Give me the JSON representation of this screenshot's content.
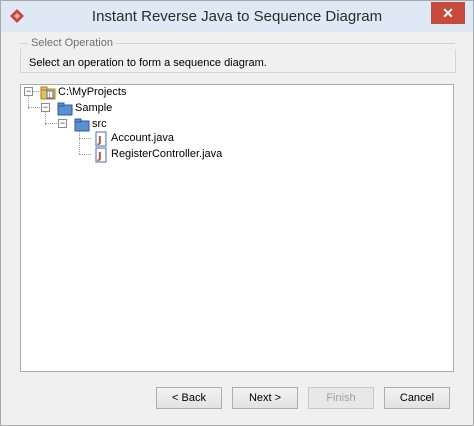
{
  "window": {
    "title": "Instant Reverse Java to Sequence Diagram",
    "close_label": "✕"
  },
  "group": {
    "label": "Select Operation",
    "instruction": "Select an operation to form a sequence diagram."
  },
  "tree": {
    "root": "C:\\MyProjects",
    "project": "Sample",
    "folder": "src",
    "files": [
      "Account.java",
      "RegisterController.java"
    ]
  },
  "buttons": {
    "back": "< Back",
    "next": "Next >",
    "finish": "Finish",
    "cancel": "Cancel"
  },
  "colors": {
    "accent_close": "#c74b3c",
    "titlebar": "#dfe9f5",
    "folder_blue": "#3d6fb6"
  }
}
